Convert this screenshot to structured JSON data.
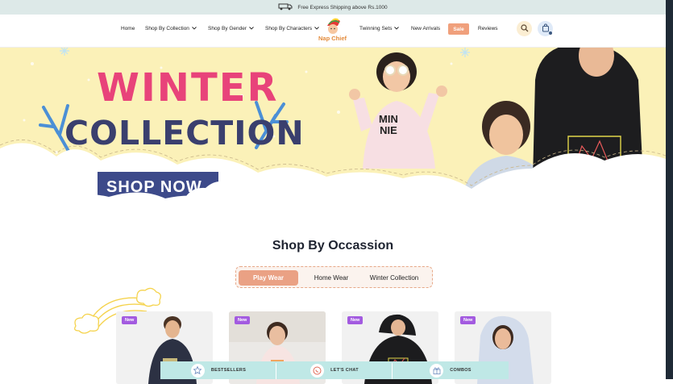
{
  "announcement": {
    "text": "Free Express Shipping above Rs.1000"
  },
  "nav": {
    "home": "Home",
    "shop_by_collection": "Shop By Collection",
    "shop_by_gender": "Shop By Gender",
    "shop_by_characters": "Shop By Characters",
    "logo_text": "Nap Chief",
    "twinning_sets": "Twinning Sets",
    "new_arrivals": "New Arrivals",
    "sale": "Sale",
    "reviews": "Reviews"
  },
  "hero": {
    "title_line1": "WINTER",
    "title_line2": "COLLECTION",
    "cta": "SHOP NOW",
    "shirt_text_top": "MIN",
    "shirt_text_bottom": "NIE"
  },
  "occasion": {
    "title": "Shop By Occassion",
    "tabs": [
      "Play Wear",
      "Home Wear",
      "Winter Collection"
    ],
    "active_tab": 0
  },
  "products": [
    {
      "badge": "New"
    },
    {
      "badge": "New"
    },
    {
      "badge": "New"
    },
    {
      "badge": "New"
    }
  ],
  "bottom_bar": {
    "items": [
      "BESTSELLERS",
      "LET'S CHAT",
      "COMBOS"
    ]
  },
  "colors": {
    "accent": "#eaa184",
    "hero_bg": "#fbf1b8",
    "cta_bg": "#3d4a8a",
    "badge": "#a35be0",
    "bottom_bar": "#bfe8e6",
    "winter_pink": "#e8437a",
    "collection_navy": "#3a3f6e"
  },
  "icons": [
    "truck-icon",
    "search-icon",
    "cart-icon",
    "snowflake-icon",
    "rainbow-icon",
    "star-icon",
    "chat-icon",
    "gift-icon"
  ]
}
